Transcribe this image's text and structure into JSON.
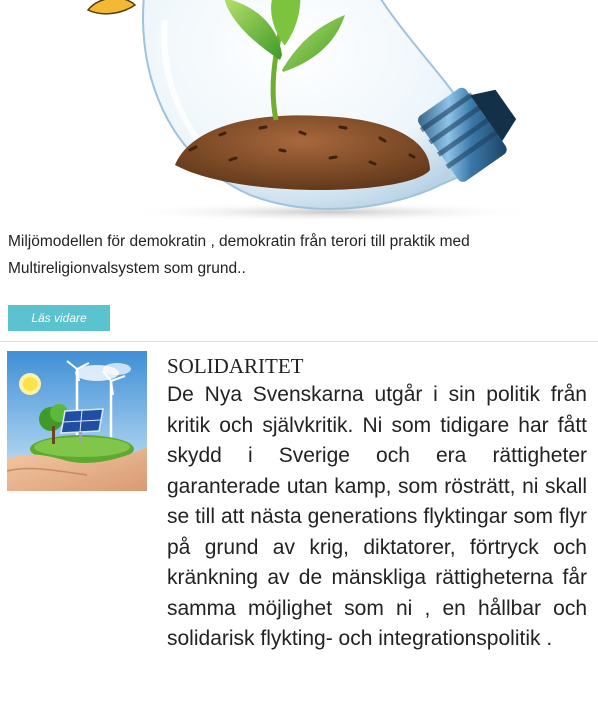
{
  "featured": {
    "image_icon": "lightbulb-plant-icon",
    "caption": "Miljömodellen för demokratin , demokratin från terori till praktik med Multireligionvalsystem som grund..",
    "read_more_label": "Läs vidare"
  },
  "article": {
    "thumbnail_icon": "renewable-energy-hand-icon",
    "title": "SOLIDARITET",
    "body": "De Nya Svenskarna utgår i sin politik från kritik och självkritik. Ni som tidigare har fått skydd i Sverige och era rättigheter garanterade utan kamp, som rösträtt, ni skall se till att nästa generations flyktingar som flyr på grund av krig, diktatorer, förtryck och kränkning av de mänskliga rättigheterna får samma möjlighet som ni , en hållbar och solidarisk flykting- och integrationspolitik ."
  },
  "colors": {
    "button_bg": "#5bc3cf",
    "divider": "#dddddd",
    "text": "#222222"
  }
}
